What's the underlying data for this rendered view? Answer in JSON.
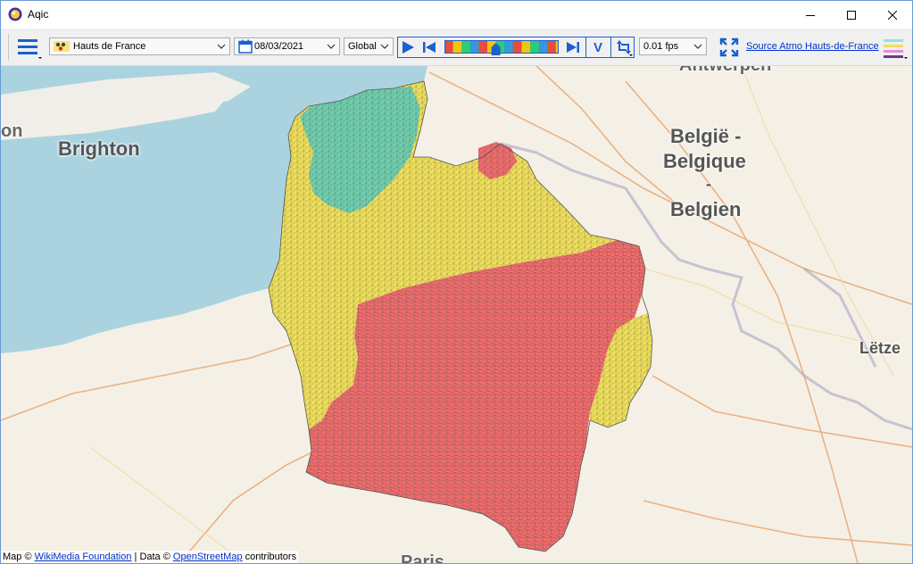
{
  "window": {
    "title": "Aqic"
  },
  "titlebar": {
    "minimize_icon": "minimize-icon",
    "maximize_icon": "maximize-icon",
    "close_icon": "close-icon"
  },
  "toolbar": {
    "menu_icon": "hamburger-menu-icon",
    "region": {
      "value": "Hauts de France"
    },
    "date": {
      "value": "08/03/2021"
    },
    "scope": {
      "value": "Global"
    },
    "fps": {
      "value": "0.01 fps"
    },
    "v_label": "V",
    "source_link": "Source Atmo Hauts-de-France",
    "timeline_colors": [
      "#e74c3c",
      "#f1c40f",
      "#2ecc71",
      "#3498db"
    ],
    "timeline_position_fraction": 0.45
  },
  "map": {
    "labels": {
      "brighton": "Brighton",
      "belgie1": "België -",
      "belgie2": "Belgique",
      "belgie3": "-",
      "belgie4": "Belgien",
      "letzebuerg": "Lëtze",
      "antwerpen": "Antwerpen",
      "on": "on",
      "paris": "Paris"
    },
    "zone_colors": {
      "good": "#6fcfae",
      "fair": "#f0e05a",
      "poor": "#f06b6b"
    },
    "attribution": {
      "prefix": "Map © ",
      "wikimedia": "WikiMedia Foundation",
      "middle": " | Data © ",
      "osm": "OpenStreetMap",
      "suffix": " contributors"
    }
  }
}
